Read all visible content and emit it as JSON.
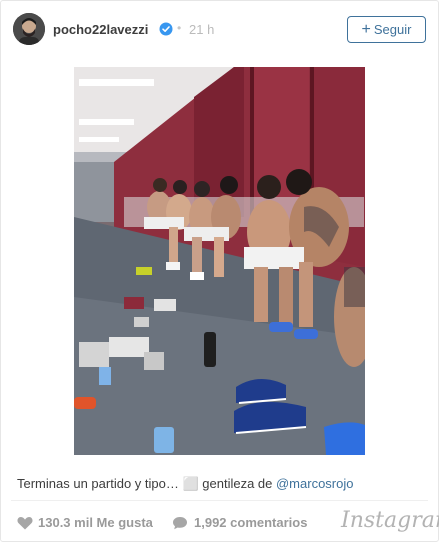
{
  "post": {
    "username": "pocho22lavezzi",
    "time": "21 h",
    "dot": "•",
    "follow_label": "Seguir",
    "follow_plus": "+"
  },
  "caption": {
    "text": "Terminas un partido y tipo… ⬜ gentileza de ",
    "mention": "@marcosrojo"
  },
  "stats": {
    "likes": "130.3 mil Me gusta",
    "comments": "1,992 comentarios"
  },
  "brand": "Instagram",
  "colors": {
    "link": "#3f729b",
    "verified": "#3897f0",
    "muted": "#9a9a9a",
    "text": "#3d3d3d"
  },
  "icons": {
    "verified": "verified-badge-icon",
    "tag": "user-tag-icon",
    "heart": "heart-icon",
    "comment": "comment-icon"
  }
}
